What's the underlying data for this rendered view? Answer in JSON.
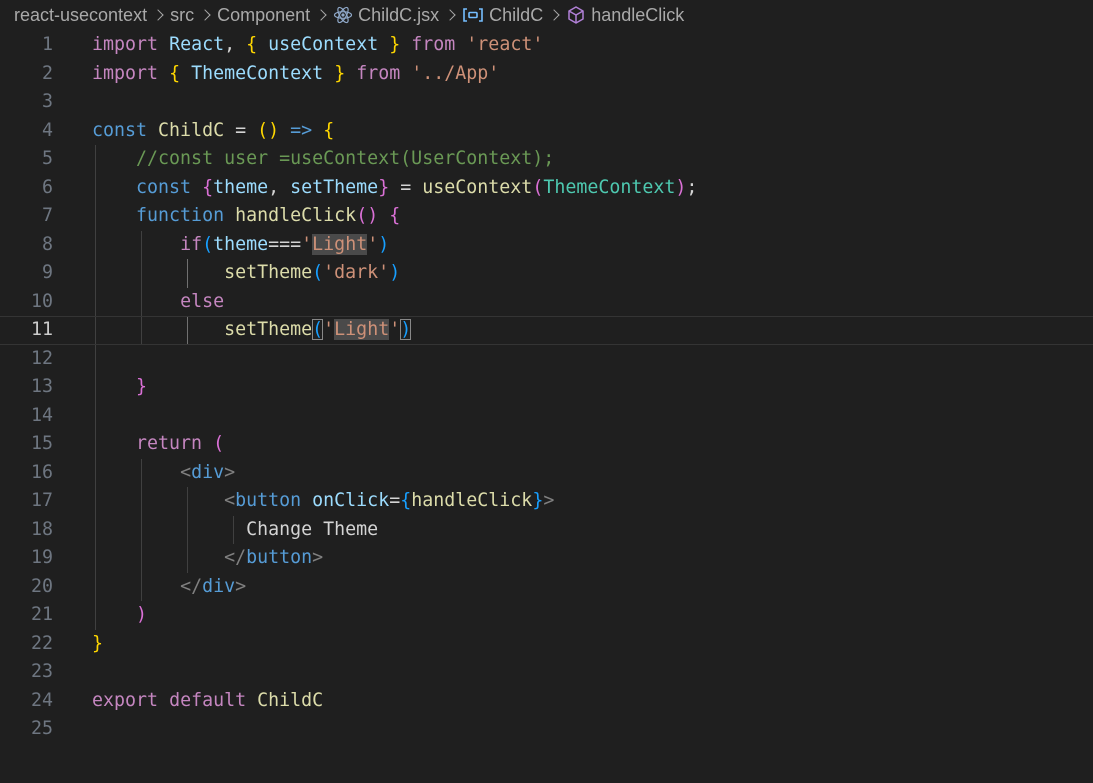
{
  "breadcrumb": {
    "project": "react-usecontext",
    "folder1": "src",
    "folder2": "Component",
    "file": "ChildC.jsx",
    "component": "ChildC",
    "symbol": "handleClick",
    "file_icon": "react-icon",
    "component_icon": "variable-icon",
    "symbol_icon": "method-cube-icon"
  },
  "editor": {
    "current_line": 11,
    "theme_background": "#1f1f1f",
    "lines": [
      {
        "n": "1",
        "tokens": [
          [
            "kw",
            "import"
          ],
          [
            "p",
            " "
          ],
          [
            "va",
            "React"
          ],
          [
            "p",
            ", "
          ],
          [
            "b1",
            "{"
          ],
          [
            "p",
            " "
          ],
          [
            "va",
            "useContext"
          ],
          [
            "p",
            " "
          ],
          [
            "b1",
            "}"
          ],
          [
            "p",
            " "
          ],
          [
            "kw",
            "from"
          ],
          [
            "p",
            " "
          ],
          [
            "s",
            "'react'"
          ]
        ]
      },
      {
        "n": "2",
        "tokens": [
          [
            "kw",
            "import"
          ],
          [
            "p",
            " "
          ],
          [
            "b1",
            "{"
          ],
          [
            "p",
            " "
          ],
          [
            "va",
            "ThemeContext"
          ],
          [
            "p",
            " "
          ],
          [
            "b1",
            "}"
          ],
          [
            "p",
            " "
          ],
          [
            "kw",
            "from"
          ],
          [
            "p",
            " "
          ],
          [
            "s",
            "'../App'"
          ]
        ]
      },
      {
        "n": "3",
        "tokens": []
      },
      {
        "n": "4",
        "tokens": [
          [
            "st",
            "const"
          ],
          [
            "p",
            " "
          ],
          [
            "fn",
            "ChildC"
          ],
          [
            "p",
            " = "
          ],
          [
            "b1",
            "()"
          ],
          [
            "p",
            " "
          ],
          [
            "st",
            "=>"
          ],
          [
            "p",
            " "
          ],
          [
            "b1",
            "{"
          ]
        ]
      },
      {
        "n": "5",
        "tokens": [
          [
            "p",
            "    "
          ],
          [
            "cm",
            "//const user =useContext(UserContext);"
          ]
        ]
      },
      {
        "n": "6",
        "tokens": [
          [
            "p",
            "    "
          ],
          [
            "st",
            "const"
          ],
          [
            "p",
            " "
          ],
          [
            "b2",
            "{"
          ],
          [
            "va",
            "theme"
          ],
          [
            "p",
            ", "
          ],
          [
            "va",
            "setTheme"
          ],
          [
            "b2",
            "}"
          ],
          [
            "p",
            " = "
          ],
          [
            "fn",
            "useContext"
          ],
          [
            "b2",
            "("
          ],
          [
            "cl",
            "ThemeContext"
          ],
          [
            "b2",
            ")"
          ],
          [
            "p",
            ";"
          ]
        ]
      },
      {
        "n": "7",
        "tokens": [
          [
            "p",
            "    "
          ],
          [
            "st",
            "function"
          ],
          [
            "p",
            " "
          ],
          [
            "fn",
            "handleClick"
          ],
          [
            "b2",
            "()"
          ],
          [
            "p",
            " "
          ],
          [
            "b2",
            "{"
          ]
        ]
      },
      {
        "n": "8",
        "tokens": [
          [
            "p",
            "        "
          ],
          [
            "kw",
            "if"
          ],
          [
            "b3",
            "("
          ],
          [
            "va",
            "theme"
          ],
          [
            "p",
            "==="
          ],
          [
            "s",
            "'"
          ],
          [
            "s hl",
            "Light"
          ],
          [
            "s",
            "'"
          ],
          [
            "b3",
            ")"
          ]
        ]
      },
      {
        "n": "9",
        "tokens": [
          [
            "p",
            "            "
          ],
          [
            "fn",
            "setTheme"
          ],
          [
            "b3",
            "("
          ],
          [
            "s",
            "'dark'"
          ],
          [
            "b3",
            ")"
          ]
        ]
      },
      {
        "n": "10",
        "tokens": [
          [
            "p",
            "        "
          ],
          [
            "kw",
            "else"
          ]
        ]
      },
      {
        "n": "11",
        "tokens": [
          [
            "p",
            "            "
          ],
          [
            "fn",
            "setTheme"
          ],
          [
            "b3 bm",
            "("
          ],
          [
            "s",
            "'"
          ],
          [
            "s hl",
            "Light"
          ],
          [
            "s",
            "'"
          ],
          [
            "b3 bm",
            ")"
          ]
        ]
      },
      {
        "n": "12",
        "tokens": []
      },
      {
        "n": "13",
        "tokens": [
          [
            "p",
            "    "
          ],
          [
            "b2",
            "}"
          ]
        ]
      },
      {
        "n": "14",
        "tokens": []
      },
      {
        "n": "15",
        "tokens": [
          [
            "p",
            "    "
          ],
          [
            "kw",
            "return"
          ],
          [
            "p",
            " "
          ],
          [
            "b2",
            "("
          ]
        ]
      },
      {
        "n": "16",
        "tokens": [
          [
            "p",
            "        "
          ],
          [
            "tg",
            "<"
          ],
          [
            "st",
            "div"
          ],
          [
            "tg",
            ">"
          ]
        ]
      },
      {
        "n": "17",
        "tokens": [
          [
            "p",
            "            "
          ],
          [
            "tg",
            "<"
          ],
          [
            "st",
            "button"
          ],
          [
            "p",
            " "
          ],
          [
            "va",
            "onClick"
          ],
          [
            "p",
            "="
          ],
          [
            "b3",
            "{"
          ],
          [
            "fn",
            "handleClick"
          ],
          [
            "b3",
            "}"
          ],
          [
            "tg",
            ">"
          ]
        ]
      },
      {
        "n": "18",
        "tokens": [
          [
            "p",
            "              Change Theme"
          ]
        ]
      },
      {
        "n": "19",
        "tokens": [
          [
            "p",
            "            "
          ],
          [
            "tg",
            "</"
          ],
          [
            "st",
            "button"
          ],
          [
            "tg",
            ">"
          ]
        ]
      },
      {
        "n": "20",
        "tokens": [
          [
            "p",
            "        "
          ],
          [
            "tg",
            "</"
          ],
          [
            "st",
            "div"
          ],
          [
            "tg",
            ">"
          ]
        ]
      },
      {
        "n": "21",
        "tokens": [
          [
            "p",
            "    "
          ],
          [
            "b2",
            ")"
          ]
        ]
      },
      {
        "n": "22",
        "tokens": [
          [
            "b1",
            "}"
          ]
        ]
      },
      {
        "n": "23",
        "tokens": []
      },
      {
        "n": "24",
        "tokens": [
          [
            "kw",
            "export"
          ],
          [
            "p",
            " "
          ],
          [
            "kw",
            "default"
          ],
          [
            "p",
            " "
          ],
          [
            "fn",
            "ChildC"
          ]
        ]
      },
      {
        "n": "25",
        "tokens": []
      }
    ]
  }
}
